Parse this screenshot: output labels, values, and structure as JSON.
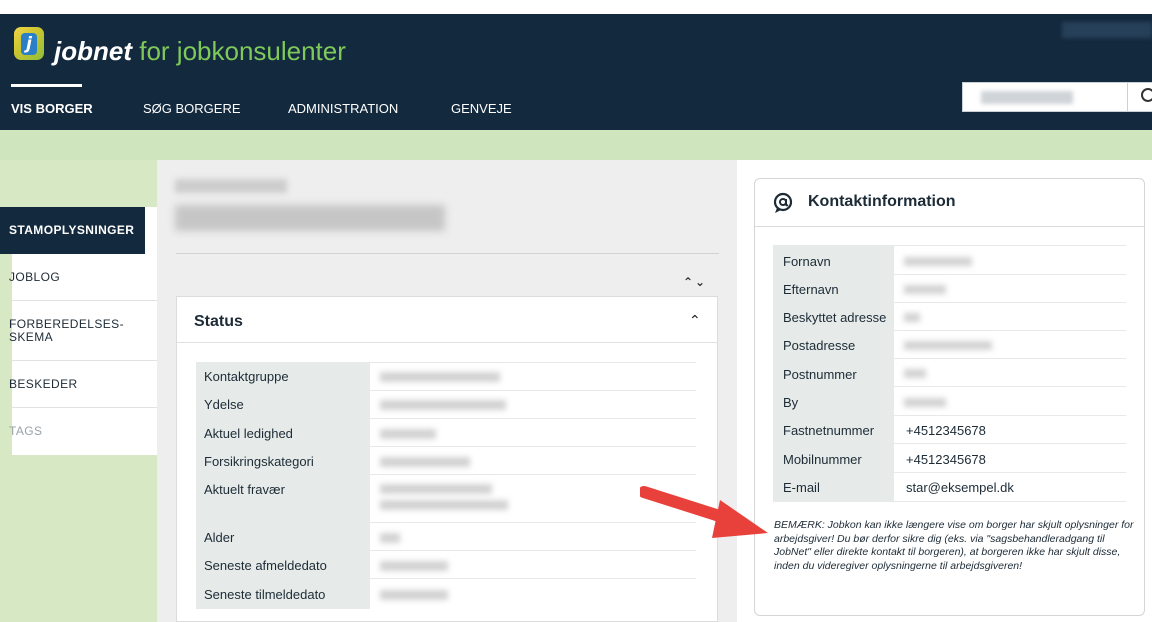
{
  "brand": {
    "name": "jobnet",
    "suffix": " for jobkonsulenter",
    "logo_letter": "j"
  },
  "nav": {
    "items": [
      "VIS BORGER",
      "SØG BORGERE",
      "ADMINISTRATION",
      "GENVEJE"
    ],
    "active_index": 0
  },
  "search": {
    "value": ""
  },
  "sidebar": {
    "items": [
      {
        "label": "STAMOPLYSNINGER",
        "state": "active"
      },
      {
        "label": "JOBLOG",
        "state": "normal"
      },
      {
        "label": "FORBEREDELSES-\nSKEMA",
        "state": "normal"
      },
      {
        "label": "BESKEDER",
        "state": "normal"
      },
      {
        "label": "TAGS",
        "state": "disabled"
      }
    ]
  },
  "status": {
    "title": "Status",
    "labels": [
      "Kontaktgruppe",
      "Ydelse",
      "Aktuel ledighed",
      "Forsikringskategori",
      "Aktuelt fravær",
      "Alder",
      "Seneste afmeldedato",
      "Seneste tilmeldedato"
    ]
  },
  "contact": {
    "title": "Kontaktinformation",
    "rows": [
      {
        "label": "Fornavn",
        "value": ""
      },
      {
        "label": "Efternavn",
        "value": ""
      },
      {
        "label": "Beskyttet adresse",
        "value": ""
      },
      {
        "label": "Postadresse",
        "value": ""
      },
      {
        "label": "Postnummer",
        "value": ""
      },
      {
        "label": "By",
        "value": ""
      },
      {
        "label": "Fastnetnummer",
        "value": "+4512345678"
      },
      {
        "label": "Mobilnummer",
        "value": "+4512345678"
      },
      {
        "label": "E-mail",
        "value": "star@eksempel.dk"
      }
    ],
    "note": "BEMÆRK: Jobkon kan ikke længere vise om borger har skjult oplysninger for arbejdsgiver! Du bør derfor sikre dig (eks. via \"sagsbehandleradgang til JobNet\" eller direkte kontakt til borgeren), at borgeren ikke har skjult disse, inden du videregiver oplysningerne til arbejdsgiveren!"
  },
  "colors": {
    "header_bg": "#13293d",
    "brand_green": "#7fc95a",
    "arrow": "#e8403a"
  },
  "icons": [
    "search-icon",
    "expand-all-icon",
    "collapse-all-icon",
    "chevron-up-icon",
    "contact-at-icon",
    "arrow-annotation"
  ]
}
